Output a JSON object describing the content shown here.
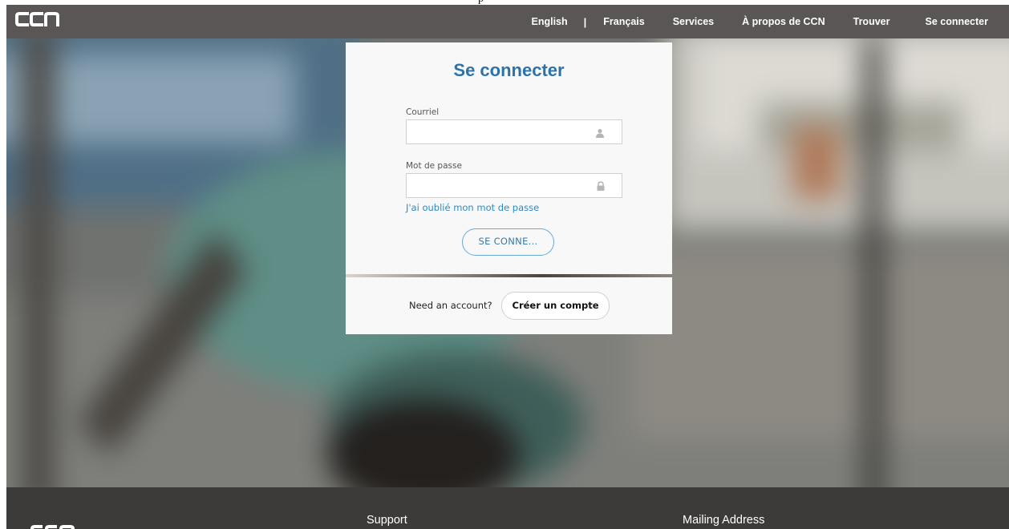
{
  "header": {
    "caption": "p",
    "logo_icon": "ccn-logo",
    "nav": [
      {
        "label": "English"
      },
      {
        "label": "|"
      },
      {
        "label": "Français"
      },
      {
        "label": "Services"
      },
      {
        "label": "À propos de CCN"
      },
      {
        "label": "Trouver"
      },
      {
        "label": "Se connecter"
      }
    ]
  },
  "login": {
    "title": "Se connecter",
    "email": {
      "label": "Courriel",
      "value": "",
      "icon": "user-icon"
    },
    "password": {
      "label": "Mot de passe",
      "value": "",
      "icon": "lock-icon"
    },
    "forgot_link": "J'ai oublié mon mot de passe",
    "submit_label": "SE CONNE..."
  },
  "signup": {
    "prompt": "Need an account?",
    "button_label": "Créer un compte"
  },
  "footer": {
    "logo_icon": "ccn-logo",
    "support_heading": "Support",
    "mailing_heading": "Mailing Address"
  },
  "colors": {
    "navbar": "#5a5656",
    "title_blue": "#2d72a8",
    "link_blue": "#2b8bc9",
    "button_border": "#6aa9d2",
    "footer": "#3d3a3a"
  }
}
